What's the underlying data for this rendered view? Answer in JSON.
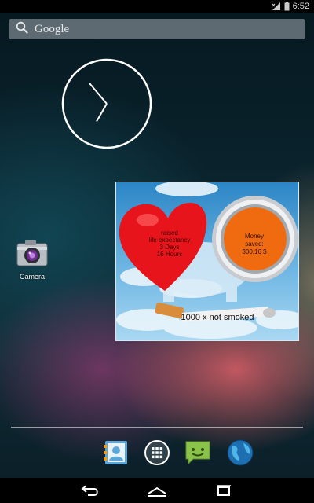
{
  "status_bar": {
    "time": "6:52",
    "icons": [
      "signal-icon",
      "battery-icon"
    ]
  },
  "search": {
    "label": "Google",
    "icon": "search-icon"
  },
  "clock": {
    "type": "analog-clock",
    "hour_angle_deg": 320,
    "minute_angle_deg": 210
  },
  "desktop_apps": [
    {
      "label": "Camera",
      "icon": "camera-icon"
    }
  ],
  "widget": {
    "heart": {
      "line1": "raised",
      "line2": "life expectancy",
      "line3": "3 Days",
      "line4": "16 Hours"
    },
    "money": {
      "line1": "Money",
      "line2": "saved:",
      "line3": "300.16 $"
    },
    "smoked": "1000 x not smoked",
    "colors": {
      "heart": "#e8141b",
      "coin": "#f06a10",
      "sky": "#4ea3dc"
    }
  },
  "dock": {
    "items": [
      "contacts-icon",
      "app-drawer-icon",
      "messaging-icon",
      "browser-globe-icon"
    ]
  },
  "nav_bar": {
    "buttons": [
      "back-icon",
      "home-icon",
      "recent-apps-icon"
    ]
  }
}
